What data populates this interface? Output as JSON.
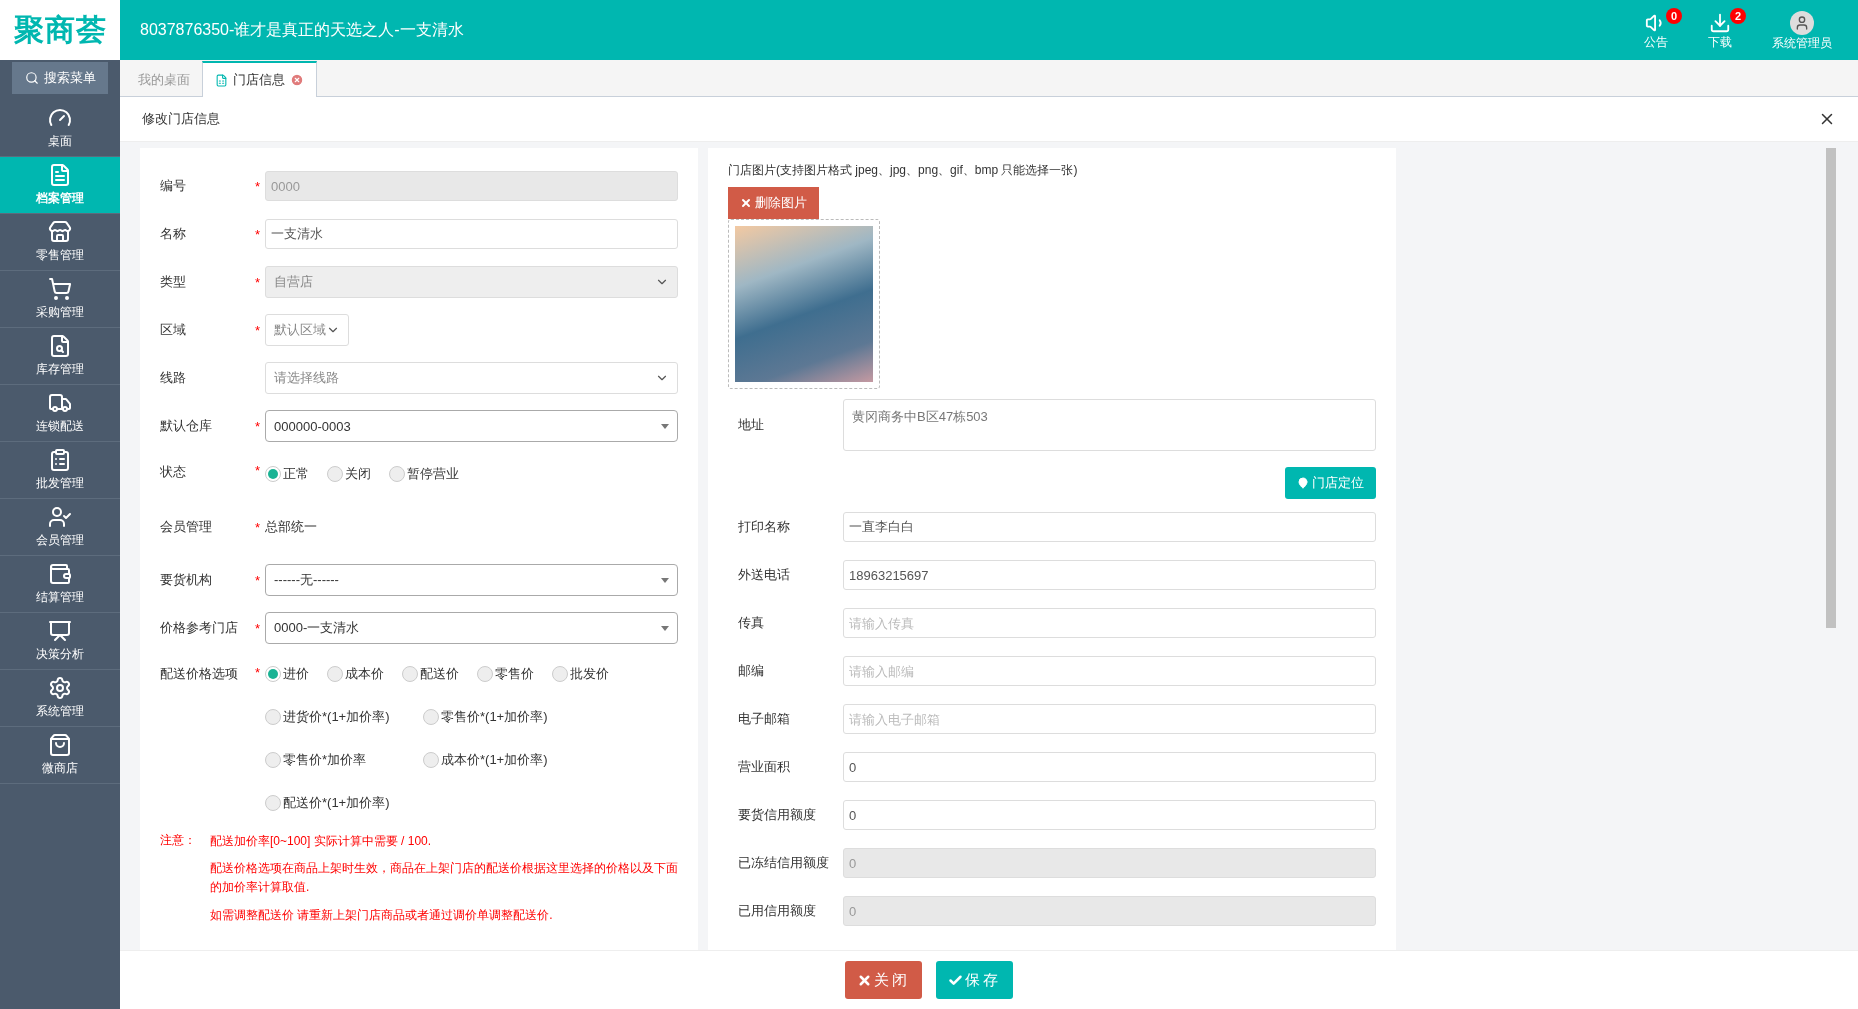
{
  "header": {
    "logo": "聚商荟",
    "title": "8037876350-谁才是真正的天选之人-一支清水",
    "actions": [
      {
        "label": "公告",
        "badge": "0"
      },
      {
        "label": "下载",
        "badge": "2"
      },
      {
        "label": "系统管理员"
      }
    ]
  },
  "sidebar": {
    "search_label": "搜索菜单",
    "items": [
      {
        "label": "桌面",
        "selected": false
      },
      {
        "label": "档案管理",
        "selected": true
      },
      {
        "label": "零售管理",
        "selected": false
      },
      {
        "label": "采购管理",
        "selected": false
      },
      {
        "label": "库存管理",
        "selected": false
      },
      {
        "label": "连锁配送",
        "selected": false
      },
      {
        "label": "批发管理",
        "selected": false
      },
      {
        "label": "会员管理",
        "selected": false
      },
      {
        "label": "结算管理",
        "selected": false
      },
      {
        "label": "决策分析",
        "selected": false
      },
      {
        "label": "系统管理",
        "selected": false
      },
      {
        "label": "微商店",
        "selected": false
      }
    ]
  },
  "tabs": [
    {
      "label": "我的桌面",
      "selected": false,
      "closable": false
    },
    {
      "label": "门店信息",
      "selected": true,
      "closable": true
    }
  ],
  "panel": {
    "title": "修改门店信息"
  },
  "left_form": {
    "fields": [
      {
        "kind": "input",
        "label": "编号",
        "required_mark": "*",
        "value": "0000",
        "disabled": true
      },
      {
        "kind": "input",
        "label": "名称",
        "required_mark": "*",
        "value": "一支清水",
        "disabled": false
      },
      {
        "kind": "select",
        "label": "类型",
        "required_mark": "*",
        "value": "自营店",
        "disabled": true
      },
      {
        "kind": "select-small",
        "label": "区域",
        "required_mark": "*",
        "value": "默认区域"
      },
      {
        "kind": "select",
        "label": "线路",
        "value": "请选择线路",
        "disabled": false
      },
      {
        "kind": "combo",
        "label": "默认仓库",
        "required_mark": "*",
        "value": "000000-0003"
      },
      {
        "kind": "radio",
        "label": "状态",
        "required_mark": "*",
        "option_rows": [
          {
            "options": [
              {
                "label": "正常",
                "selected": true
              },
              {
                "label": "关闭",
                "selected": false
              },
              {
                "label": "暂停营业",
                "selected": false
              }
            ]
          }
        ]
      },
      {
        "kind": "text",
        "label": "会员管理",
        "required_mark": "*",
        "value": "总部统一"
      },
      {
        "kind": "combo",
        "label": "要货机构",
        "required_mark": "*",
        "value": "------无------"
      },
      {
        "kind": "combo",
        "label": "价格参考门店",
        "required_mark": "*",
        "value": "0000-一支清水"
      },
      {
        "kind": "radio",
        "label": "配送价格选项",
        "required_mark": "*",
        "option_rows": [
          {
            "options": [
              {
                "label": "进价",
                "selected": true
              },
              {
                "label": "成本价",
                "selected": false
              },
              {
                "label": "配送价",
                "selected": false
              },
              {
                "label": "零售价",
                "selected": false
              },
              {
                "label": "批发价",
                "selected": false
              }
            ]
          },
          {
            "options": [
              {
                "label": "进货价*(1+加价率)",
                "selected": false
              },
              {
                "label": "零售价*(1+加价率)",
                "selected": false
              }
            ]
          },
          {
            "options": [
              {
                "label": "零售价*加价率",
                "selected": false
              },
              {
                "label": "成本价*(1+加价率)",
                "selected": false
              }
            ]
          },
          {
            "options": [
              {
                "label": "配送价*(1+加价率)",
                "selected": false
              }
            ]
          }
        ]
      }
    ],
    "notes": {
      "label": "注意：",
      "lines": [
        "配送加价率[0~100] 实际计算中需要 / 100.",
        "配送价格选项在商品上架时生效，商品在上架门店的配送价根据这里选择的价格以及下面的加价率计算取值.",
        "如需调整配送价 请重新上架门店商品或者通过调价单调整配送价."
      ]
    }
  },
  "right_form": {
    "image_caption": "门店图片(支持图片格式 jpeg、jpg、png、gif、bmp 只能选择一张)",
    "delete_button": "删除图片",
    "address": {
      "label": "地址",
      "value": "黄冈商务中B区47栋503"
    },
    "locate_button": "门店定位",
    "fields": [
      {
        "label": "打印名称",
        "value": "一直李白白",
        "disabled": false
      },
      {
        "label": "外送电话",
        "value": "18963215697",
        "disabled": false
      },
      {
        "label": "传真",
        "placeholder": "请输入传真",
        "disabled": false
      },
      {
        "label": "邮编",
        "placeholder": "请输入邮编",
        "disabled": false
      },
      {
        "label": "电子邮箱",
        "placeholder": "请输入电子邮箱",
        "disabled": false
      },
      {
        "label": "营业面积",
        "value": "0",
        "disabled": false
      },
      {
        "label": "要货信用额度",
        "value": "0",
        "disabled": false
      },
      {
        "label": "已冻结信用额度",
        "value": "0",
        "disabled": true
      },
      {
        "label": "已用信用额度",
        "value": "0",
        "disabled": true
      }
    ]
  },
  "footer": {
    "buttons": [
      {
        "kind": "close",
        "label": "关闭"
      },
      {
        "kind": "save",
        "label": "保存"
      }
    ]
  }
}
